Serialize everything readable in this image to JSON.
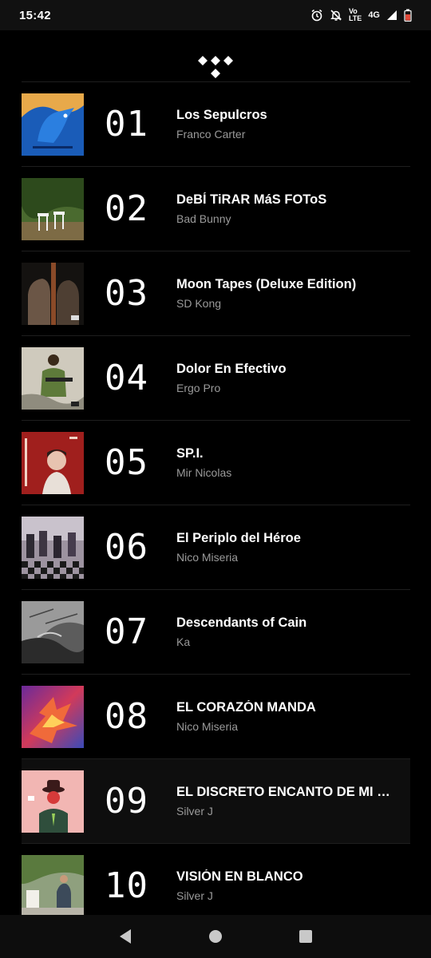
{
  "status": {
    "time": "15:42",
    "volte_top": "Vo",
    "volte_bottom": "LTE",
    "network": "4G",
    "icons": [
      "alarm-icon",
      "notifications-off-icon",
      "signal-icon",
      "battery-icon"
    ]
  },
  "app": {
    "logo": "tidal-logo"
  },
  "albums": [
    {
      "rank": "01",
      "title": "Los Sepulcros",
      "artist": "Franco Carter",
      "cover_colors": [
        "#1a4f9c",
        "#0a2a66"
      ]
    },
    {
      "rank": "02",
      "title": "DeBÍ TiRAR MáS FOToS",
      "artist": "Bad Bunny",
      "cover_colors": [
        "#3f5a2a",
        "#8a7c4a"
      ]
    },
    {
      "rank": "03",
      "title": "Moon Tapes (Deluxe Edition)",
      "artist": "SD Kong",
      "cover_colors": [
        "#1d1a18",
        "#5a4a3e"
      ]
    },
    {
      "rank": "04",
      "title": "Dolor En Efectivo",
      "artist": "Ergo Pro",
      "cover_colors": [
        "#c9c4b6",
        "#5f6a40"
      ]
    },
    {
      "rank": "05",
      "title": "SP.I.",
      "artist": "Mir Nicolas",
      "cover_colors": [
        "#a4201e",
        "#e2c8b8"
      ]
    },
    {
      "rank": "06",
      "title": "El Periplo del Héroe",
      "artist": "Nico Miseria",
      "cover_colors": [
        "#8a7f8e",
        "#3b3344"
      ]
    },
    {
      "rank": "07",
      "title": "Descendants of Cain",
      "artist": "Ka",
      "cover_colors": [
        "#888888",
        "#2a2a2a"
      ]
    },
    {
      "rank": "08",
      "title": "EL CORAZÓN MANDA",
      "artist": "Nico Miseria",
      "cover_colors": [
        "#e14a3a",
        "#6a2a9a"
      ]
    },
    {
      "rank": "09",
      "title": "EL DISCRETO ENCANTO DE MI E...",
      "artist": "Silver J",
      "cover_colors": [
        "#f2b6b3",
        "#2f6e3c"
      ]
    },
    {
      "rank": "10",
      "title": "VISIÓN EN BLANCO",
      "artist": "Silver J",
      "cover_colors": [
        "#8f9a7e",
        "#e8e4da"
      ]
    }
  ],
  "nav": {
    "icons": [
      "back-icon",
      "home-icon",
      "recents-icon"
    ]
  }
}
